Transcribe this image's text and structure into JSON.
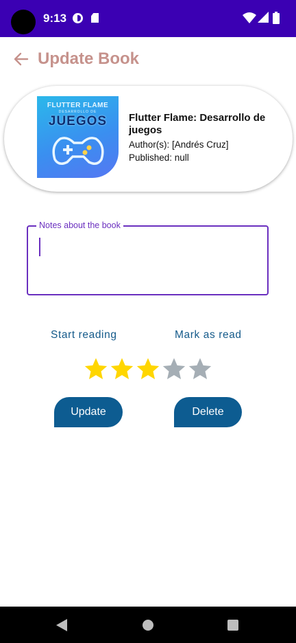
{
  "status_bar": {
    "time": "9:13",
    "icons": [
      "camera-hole",
      "p-icon",
      "sd-card-icon",
      "wifi-icon",
      "signal-icon",
      "battery-icon"
    ]
  },
  "app_bar": {
    "title": "Update Book",
    "back_icon": "arrow-left-icon",
    "title_color": "#c6928c"
  },
  "book": {
    "title": "Flutter Flame: Desarrollo de juegos",
    "author": "Author(s): [Andrés Cruz]",
    "published": "Published: null",
    "cover": {
      "line1": "FLUTTER FLAME",
      "line2": "DESARROLLO DE",
      "line3": "JUEGOS"
    }
  },
  "notes": {
    "label": "Notes about the book",
    "value": "",
    "border_color": "#6a2fbf"
  },
  "actions": {
    "start_reading": "Start reading",
    "mark_as_read": "Mark as read",
    "update": "Update",
    "delete": "Delete"
  },
  "rating": {
    "value": 3,
    "max": 5,
    "filled_color": "#ffd600",
    "empty_color": "#a5aeb5"
  },
  "colors": {
    "status_bar": "#3b00b3",
    "button": "#0d5c91",
    "link": "#145a8a"
  },
  "nav_bar": {
    "icons": [
      "back-triangle-icon",
      "home-circle-icon",
      "recents-square-icon"
    ]
  }
}
